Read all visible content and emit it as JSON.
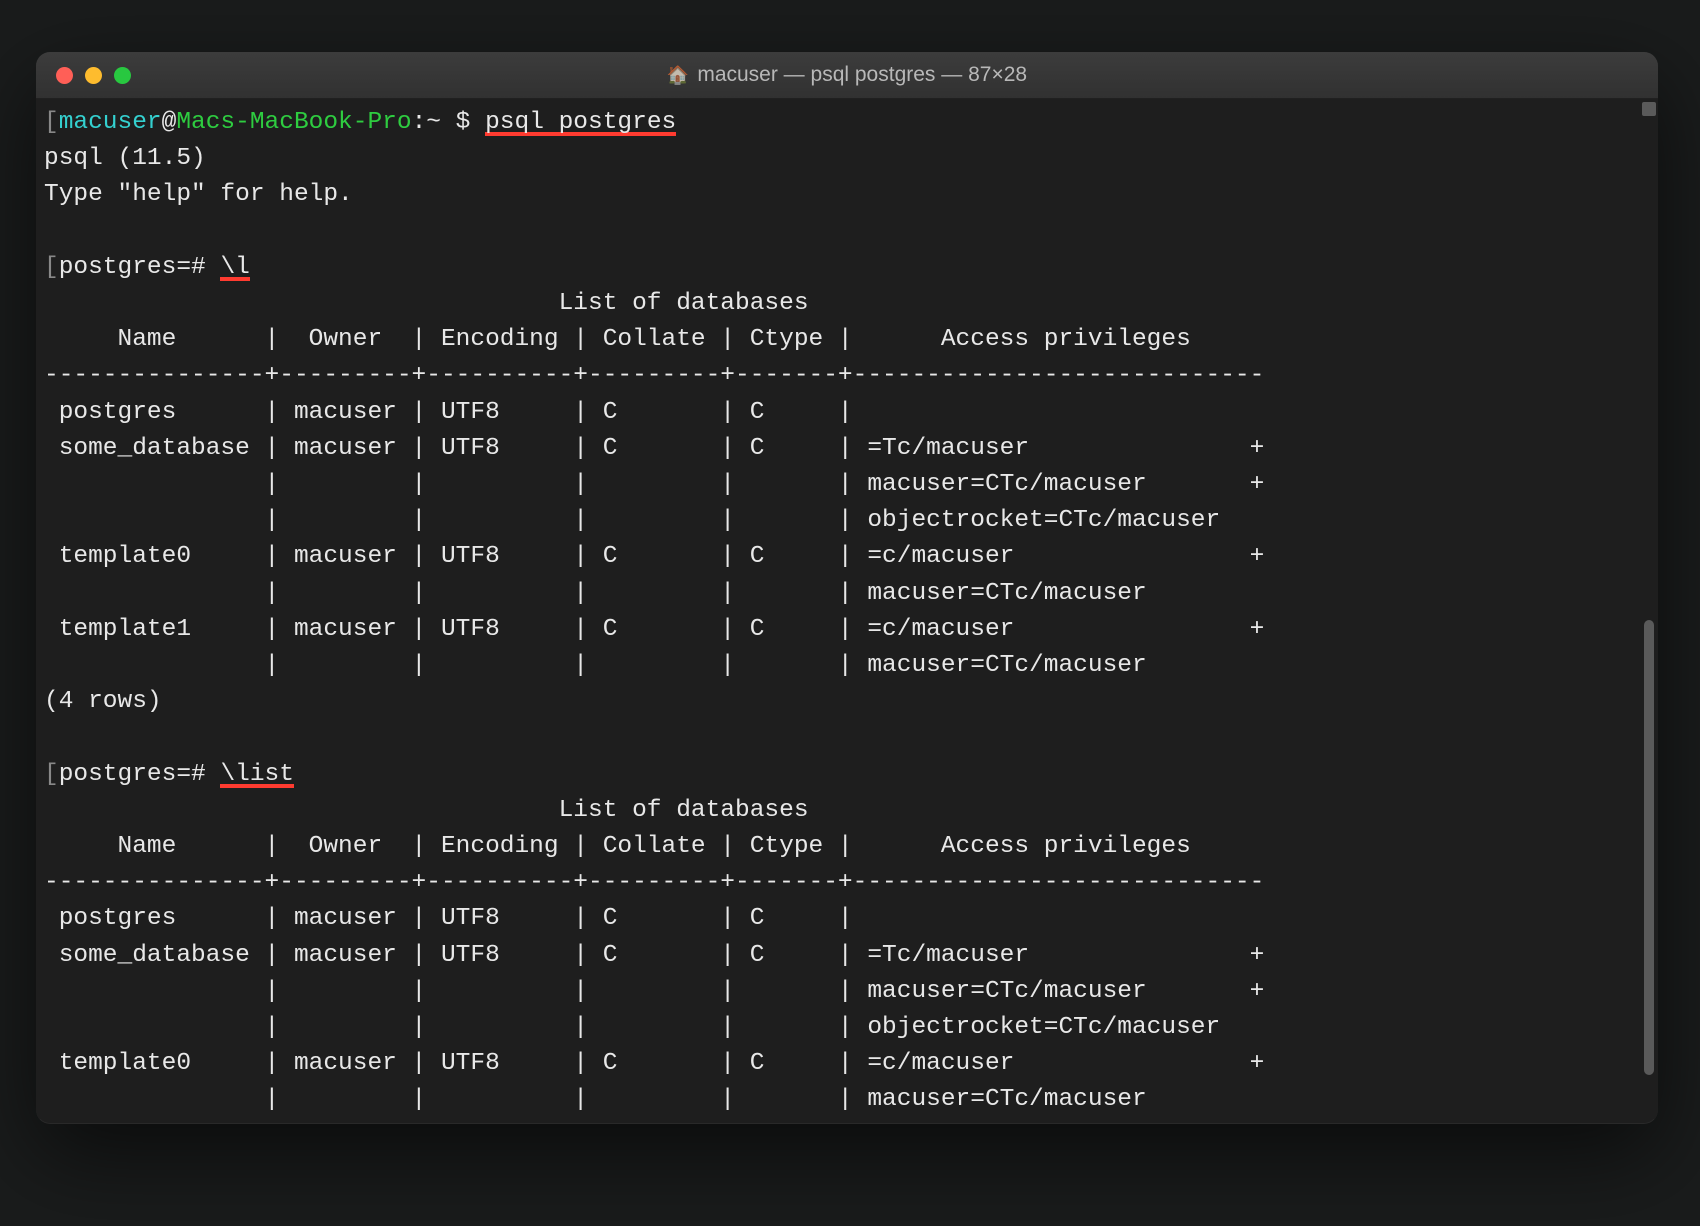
{
  "window": {
    "title": "macuser — psql postgres — 87×28",
    "traffic_lights": {
      "red": "#ff5f57",
      "yellow": "#febc2e",
      "green": "#28c840"
    }
  },
  "scrollbar": {
    "visible": true
  },
  "terminal": {
    "prompt1": {
      "user": "macuser",
      "host": "Macs-MacBook-Pro",
      "sep": ":",
      "dir": "~",
      "sym": "$",
      "cmd": "psql postgres"
    },
    "psql_version_line": "psql (11.5)",
    "help_line": "Type \"help\" for help.",
    "blank": "",
    "prompt2": {
      "db": "postgres",
      "sym": "=#",
      "cmd": "\\l"
    },
    "table1": {
      "title": "                                   List of databases",
      "header": "     Name      |  Owner  | Encoding | Collate | Ctype |      Access privileges     ",
      "divider": "---------------+---------+----------+---------+-------+----------------------------",
      "rows": [
        " postgres      | macuser | UTF8     | C       | C     | ",
        " some_database | macuser | UTF8     | C       | C     | =Tc/macuser               +",
        "               |         |          |         |       | macuser=CTc/macuser       +",
        "               |         |          |         |       | objectrocket=CTc/macuser",
        " template0     | macuser | UTF8     | C       | C     | =c/macuser                +",
        "               |         |          |         |       | macuser=CTc/macuser",
        " template1     | macuser | UTF8     | C       | C     | =c/macuser                +",
        "               |         |          |         |       | macuser=CTc/macuser"
      ],
      "footer": "(4 rows)"
    },
    "prompt3": {
      "db": "postgres",
      "sym": "=#",
      "cmd": "\\list"
    },
    "table2": {
      "title": "                                   List of databases",
      "header": "     Name      |  Owner  | Encoding | Collate | Ctype |      Access privileges     ",
      "divider": "---------------+---------+----------+---------+-------+----------------------------",
      "rows": [
        " postgres      | macuser | UTF8     | C       | C     | ",
        " some_database | macuser | UTF8     | C       | C     | =Tc/macuser               +",
        "               |         |          |         |       | macuser=CTc/macuser       +",
        "               |         |          |         |       | objectrocket=CTc/macuser",
        " template0     | macuser | UTF8     | C       | C     | =c/macuser                +",
        "               |         |          |         |       | macuser=CTc/macuser"
      ]
    }
  }
}
